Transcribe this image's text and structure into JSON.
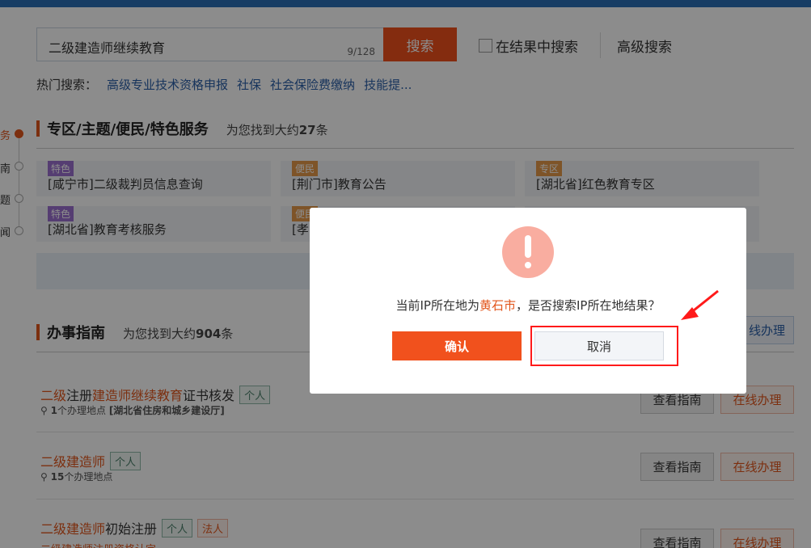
{
  "search": {
    "value": "二级建造师继续教育",
    "char_count": "9/128",
    "button_label": "搜索"
  },
  "in_results_label": "在结果中搜索",
  "advanced_label": "高级搜索",
  "hot": {
    "label": "热门搜索：",
    "links": [
      "高级专业技术资格申报",
      "社保",
      "社会保险费缴纳",
      "技能提..."
    ]
  },
  "sidenav": [
    "务",
    "南",
    "题",
    "闻"
  ],
  "special": {
    "title": "专区/主题/便民/特色服务",
    "count_prefix": "为您找到大约",
    "count": "27",
    "count_suffix": "条",
    "cards": [
      {
        "tag": "特色",
        "text": "[咸宁市]二级裁判员信息查询"
      },
      {
        "tag": "便民",
        "text": "[荆门市]教育公告"
      },
      {
        "tag": "专区",
        "text": "[湖北省]红色教育专区"
      },
      {
        "tag": "特色",
        "text": "[湖北省]教育考核服务"
      },
      {
        "tag": "便民",
        "text": "[孝"
      }
    ]
  },
  "guide": {
    "title": "办事指南",
    "count_prefix": "为您找到大约",
    "count": "904",
    "count_suffix": "条",
    "online_partial": "线办理",
    "rows": [
      {
        "pre": "二级",
        "mid": "注册",
        "hl2": "建造师继续教育",
        "post": "证书核发",
        "badges": [
          "个人"
        ],
        "meta_num": "1",
        "meta_text": "个办理地点",
        "meta_place": "[湖北省住房和城乡建设厅]"
      },
      {
        "pre": "二级建造师",
        "mid": "",
        "hl2": "",
        "post": "",
        "badges": [
          "个人"
        ],
        "meta_num": "15",
        "meta_text": "个办理地点",
        "meta_place": ""
      },
      {
        "pre": "二级建造师",
        "mid": "初始注册",
        "hl2": "",
        "post": "",
        "badges": [
          "个人",
          "法人"
        ],
        "meta_num": "",
        "meta_text": "",
        "meta_place": ""
      }
    ],
    "view_label": "查看指南",
    "online_label": "在线办理",
    "cut_row_text": "二级建造师注册资格认定"
  },
  "dialog": {
    "msg_prefix": "当前IP所在地为",
    "city": "黄石市",
    "msg_suffix": "，是否搜索IP所在地结果？",
    "confirm_label": "确认",
    "cancel_label": "取消"
  },
  "colors": {
    "accent": "#f1511d",
    "link": "#2b5fa8",
    "annotation": "#ff1a1a"
  }
}
